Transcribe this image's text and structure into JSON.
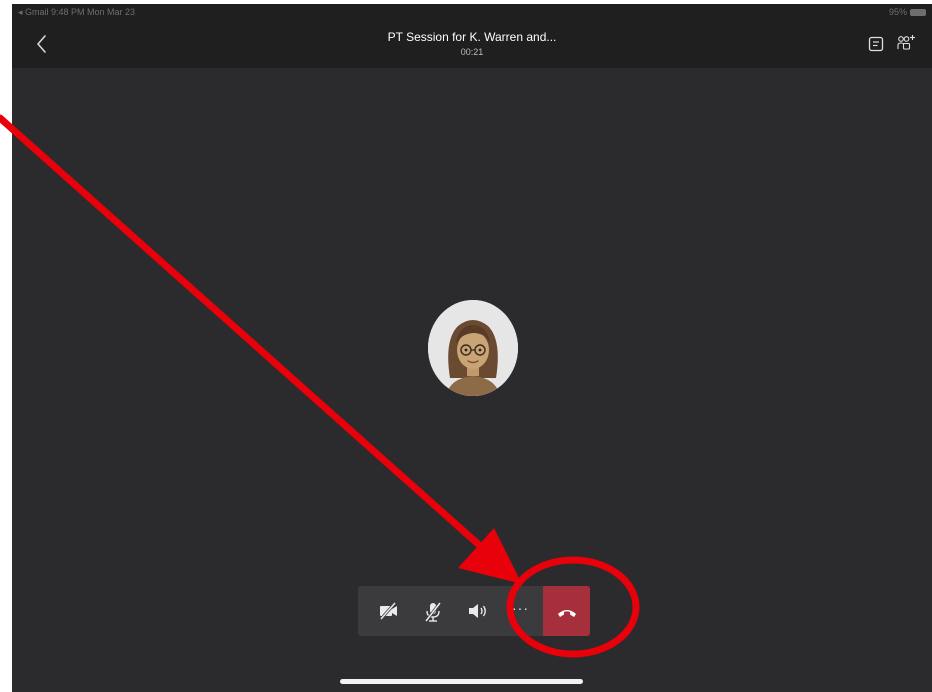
{
  "status_bar": {
    "left_text": "◂ Gmail  9:48 PM  Mon Mar 23",
    "right_text": "95%"
  },
  "header": {
    "title": "PT Session for K. Warren and...",
    "timer": "00:21"
  },
  "controls": {
    "more_label": "···"
  },
  "colors": {
    "background": "#2b2a2c",
    "header": "#1f1f1f",
    "control_bar": "#3b3a3c",
    "hangup": "#a5303c",
    "annotation": "#e8000b"
  },
  "icons": [
    "back-chevron-icon",
    "chat-icon",
    "participants-icon",
    "camera-off-icon",
    "mic-off-icon",
    "speaker-icon",
    "more-icon",
    "hang-up-icon"
  ]
}
